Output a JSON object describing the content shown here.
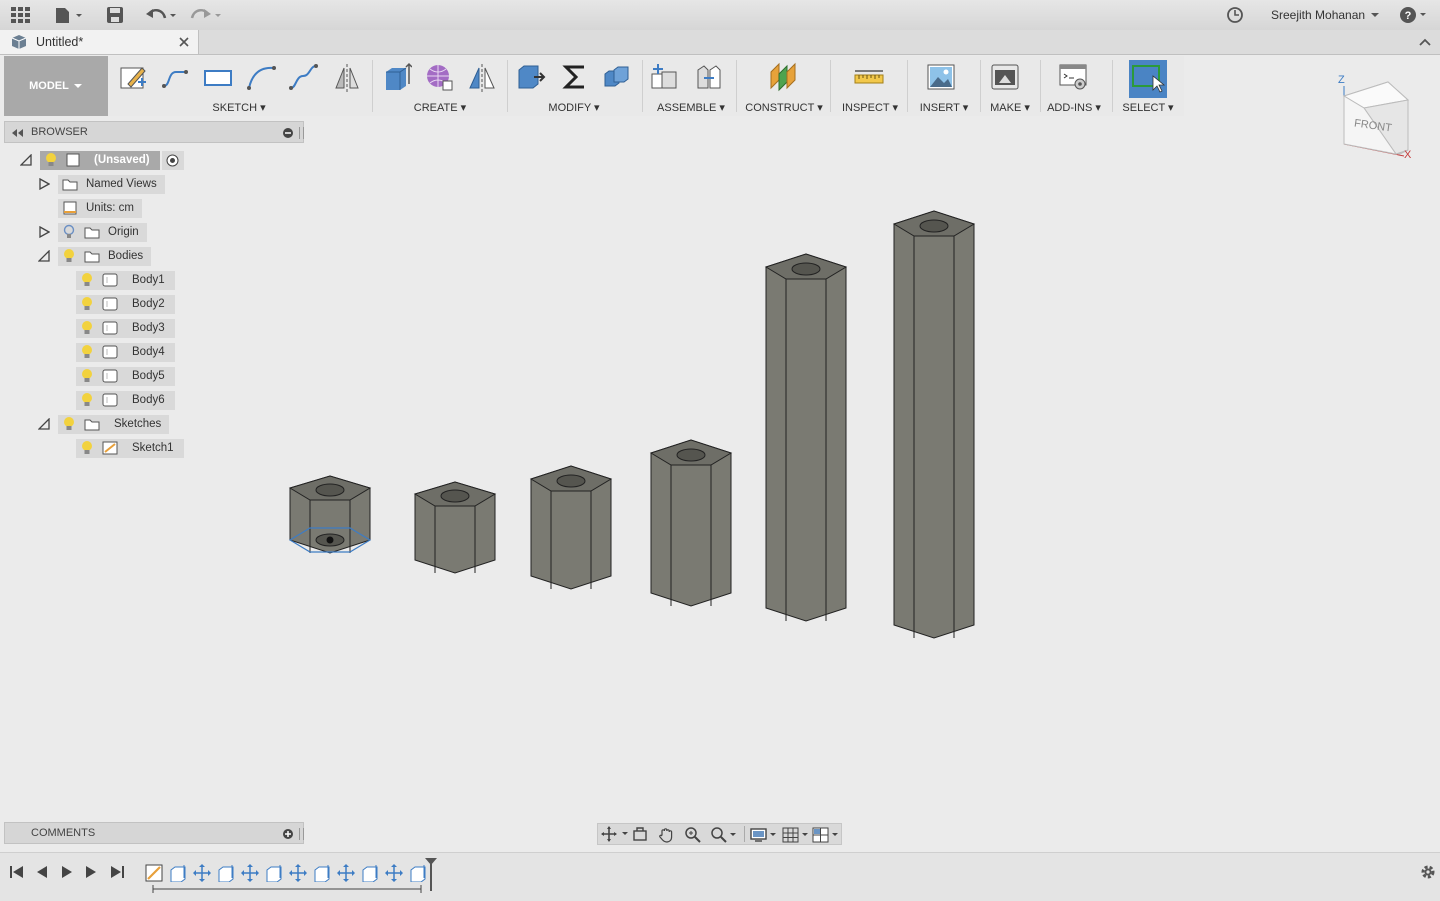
{
  "topbar": {
    "user_name": "Sreejith Mohanan"
  },
  "document": {
    "tab_title": "Untitled*"
  },
  "toolbar": {
    "mode_label": "MODEL",
    "groups": {
      "sketch": "SKETCH",
      "create": "CREATE",
      "modify": "MODIFY",
      "assemble": "ASSEMBLE",
      "construct": "CONSTRUCT",
      "inspect": "INSPECT",
      "insert": "INSERT",
      "make": "MAKE",
      "addins": "ADD-INS",
      "select": "SELECT"
    }
  },
  "browser": {
    "title": "BROWSER",
    "root": "(Unsaved)",
    "named_views": "Named Views",
    "units": "Units: cm",
    "origin": "Origin",
    "bodies": "Bodies",
    "body_items": [
      "Body1",
      "Body2",
      "Body3",
      "Body4",
      "Body5",
      "Body6"
    ],
    "sketches": "Sketches",
    "sketch_items": [
      "Sketch1"
    ]
  },
  "viewcube": {
    "face": "FRONT",
    "axis_z": "Z",
    "axis_x": "X"
  },
  "comments": {
    "title": "COMMENTS"
  },
  "colors": {
    "accent": "#3d7cc4",
    "body": "#7a7a72",
    "select_active": "#4a84c4"
  }
}
